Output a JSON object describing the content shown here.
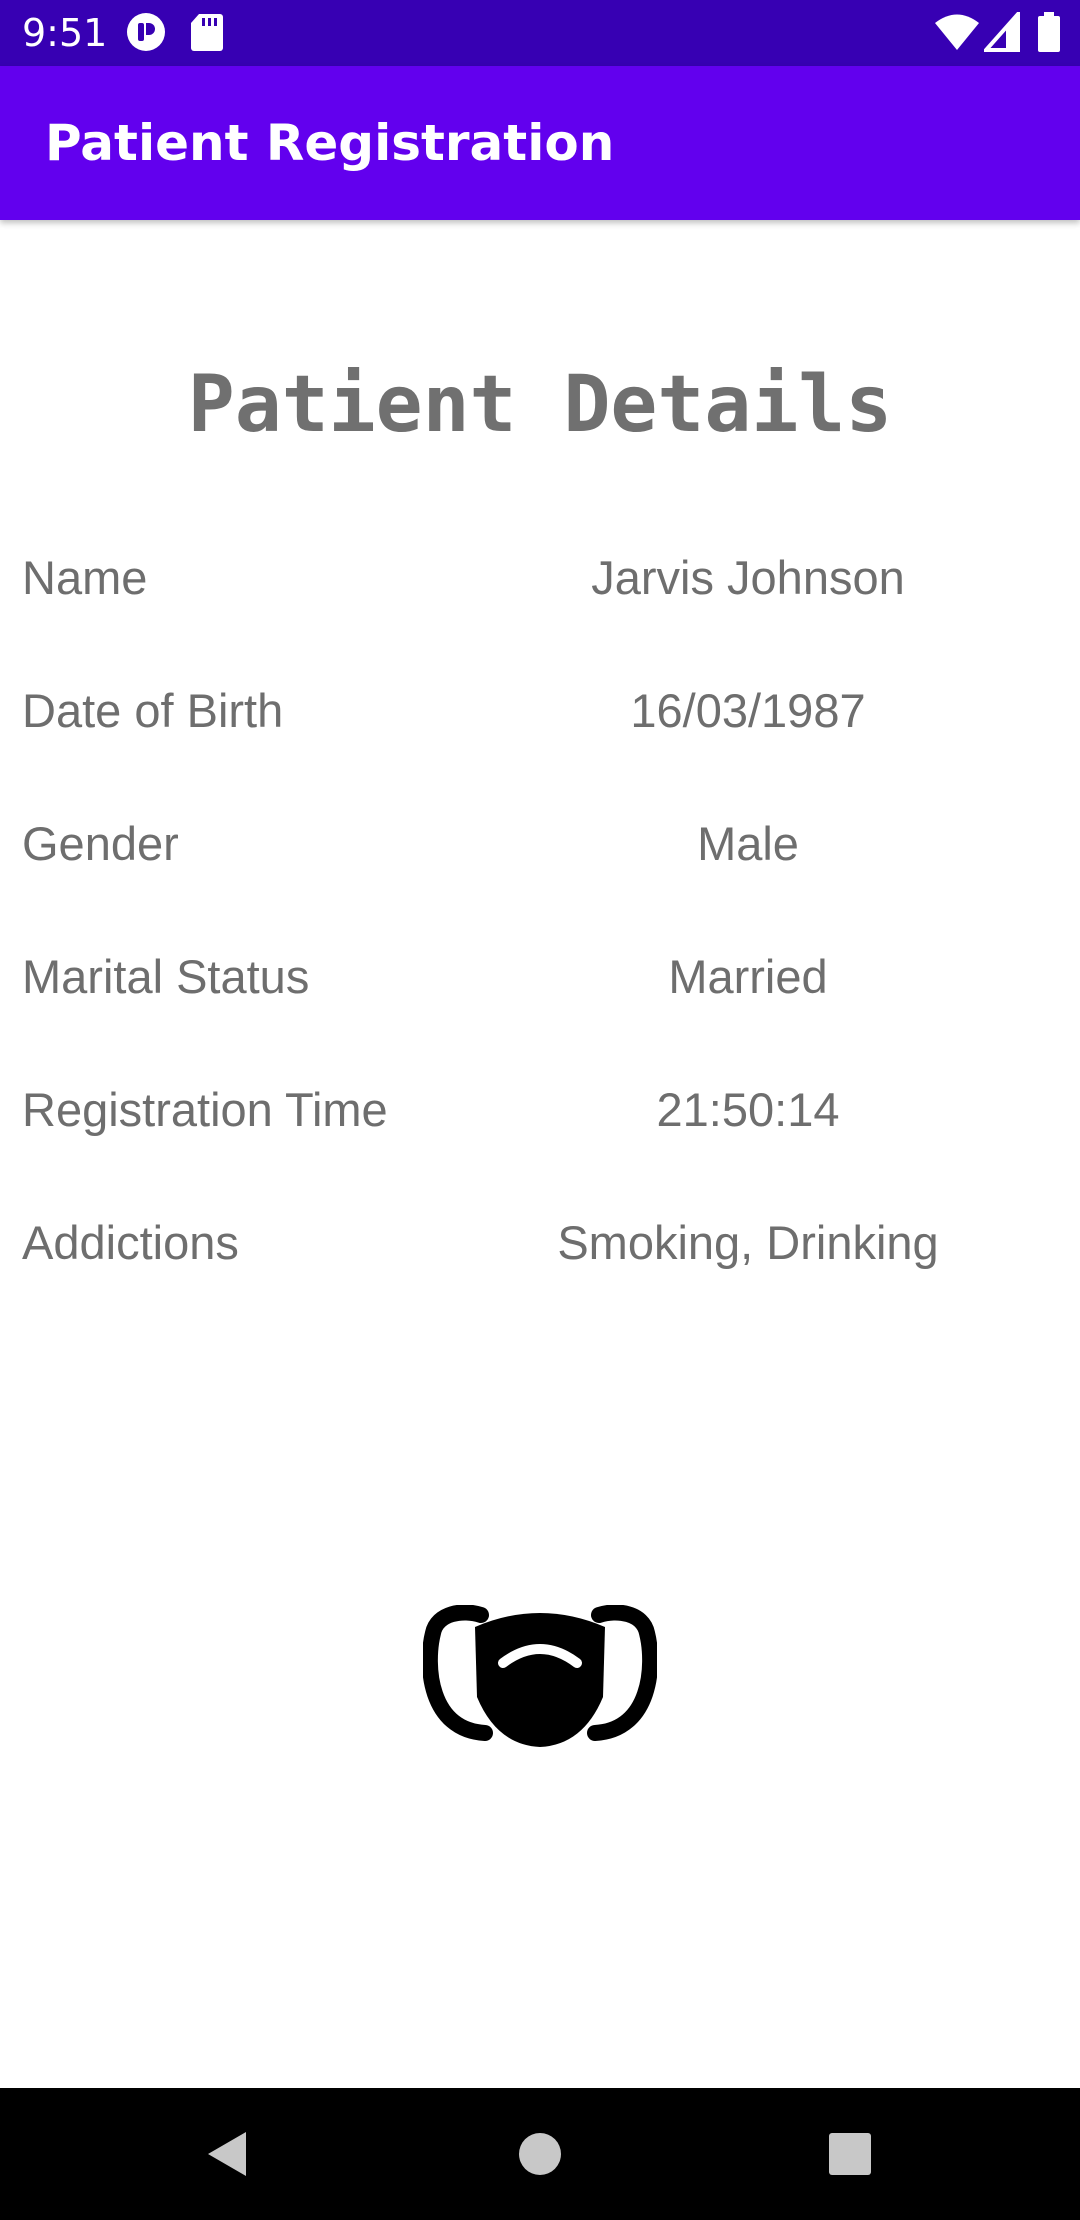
{
  "status_bar": {
    "time": "9:51",
    "left_icons": [
      "notification-app-icon",
      "sd-card-icon"
    ],
    "right_icons": [
      "wifi-icon",
      "signal-icon",
      "battery-icon"
    ]
  },
  "app_bar": {
    "title": "Patient Registration"
  },
  "main": {
    "heading": "Patient Details",
    "rows": [
      {
        "label": "Name",
        "value": "Jarvis Johnson"
      },
      {
        "label": "Date of Birth",
        "value": "16/03/1987"
      },
      {
        "label": "Gender",
        "value": "Male"
      },
      {
        "label": "Marital Status",
        "value": "Married"
      },
      {
        "label": "Registration Time",
        "value": "21:50:14"
      },
      {
        "label": "Addictions",
        "value": "Smoking, Drinking"
      }
    ],
    "illustration_icon": "face-mask-icon"
  },
  "nav_bar": {
    "buttons": [
      "back-icon",
      "home-icon",
      "recents-icon"
    ]
  },
  "colors": {
    "status_bar": "#3700b3",
    "app_bar": "#6200ee",
    "text_gray": "#6e6e6e"
  }
}
